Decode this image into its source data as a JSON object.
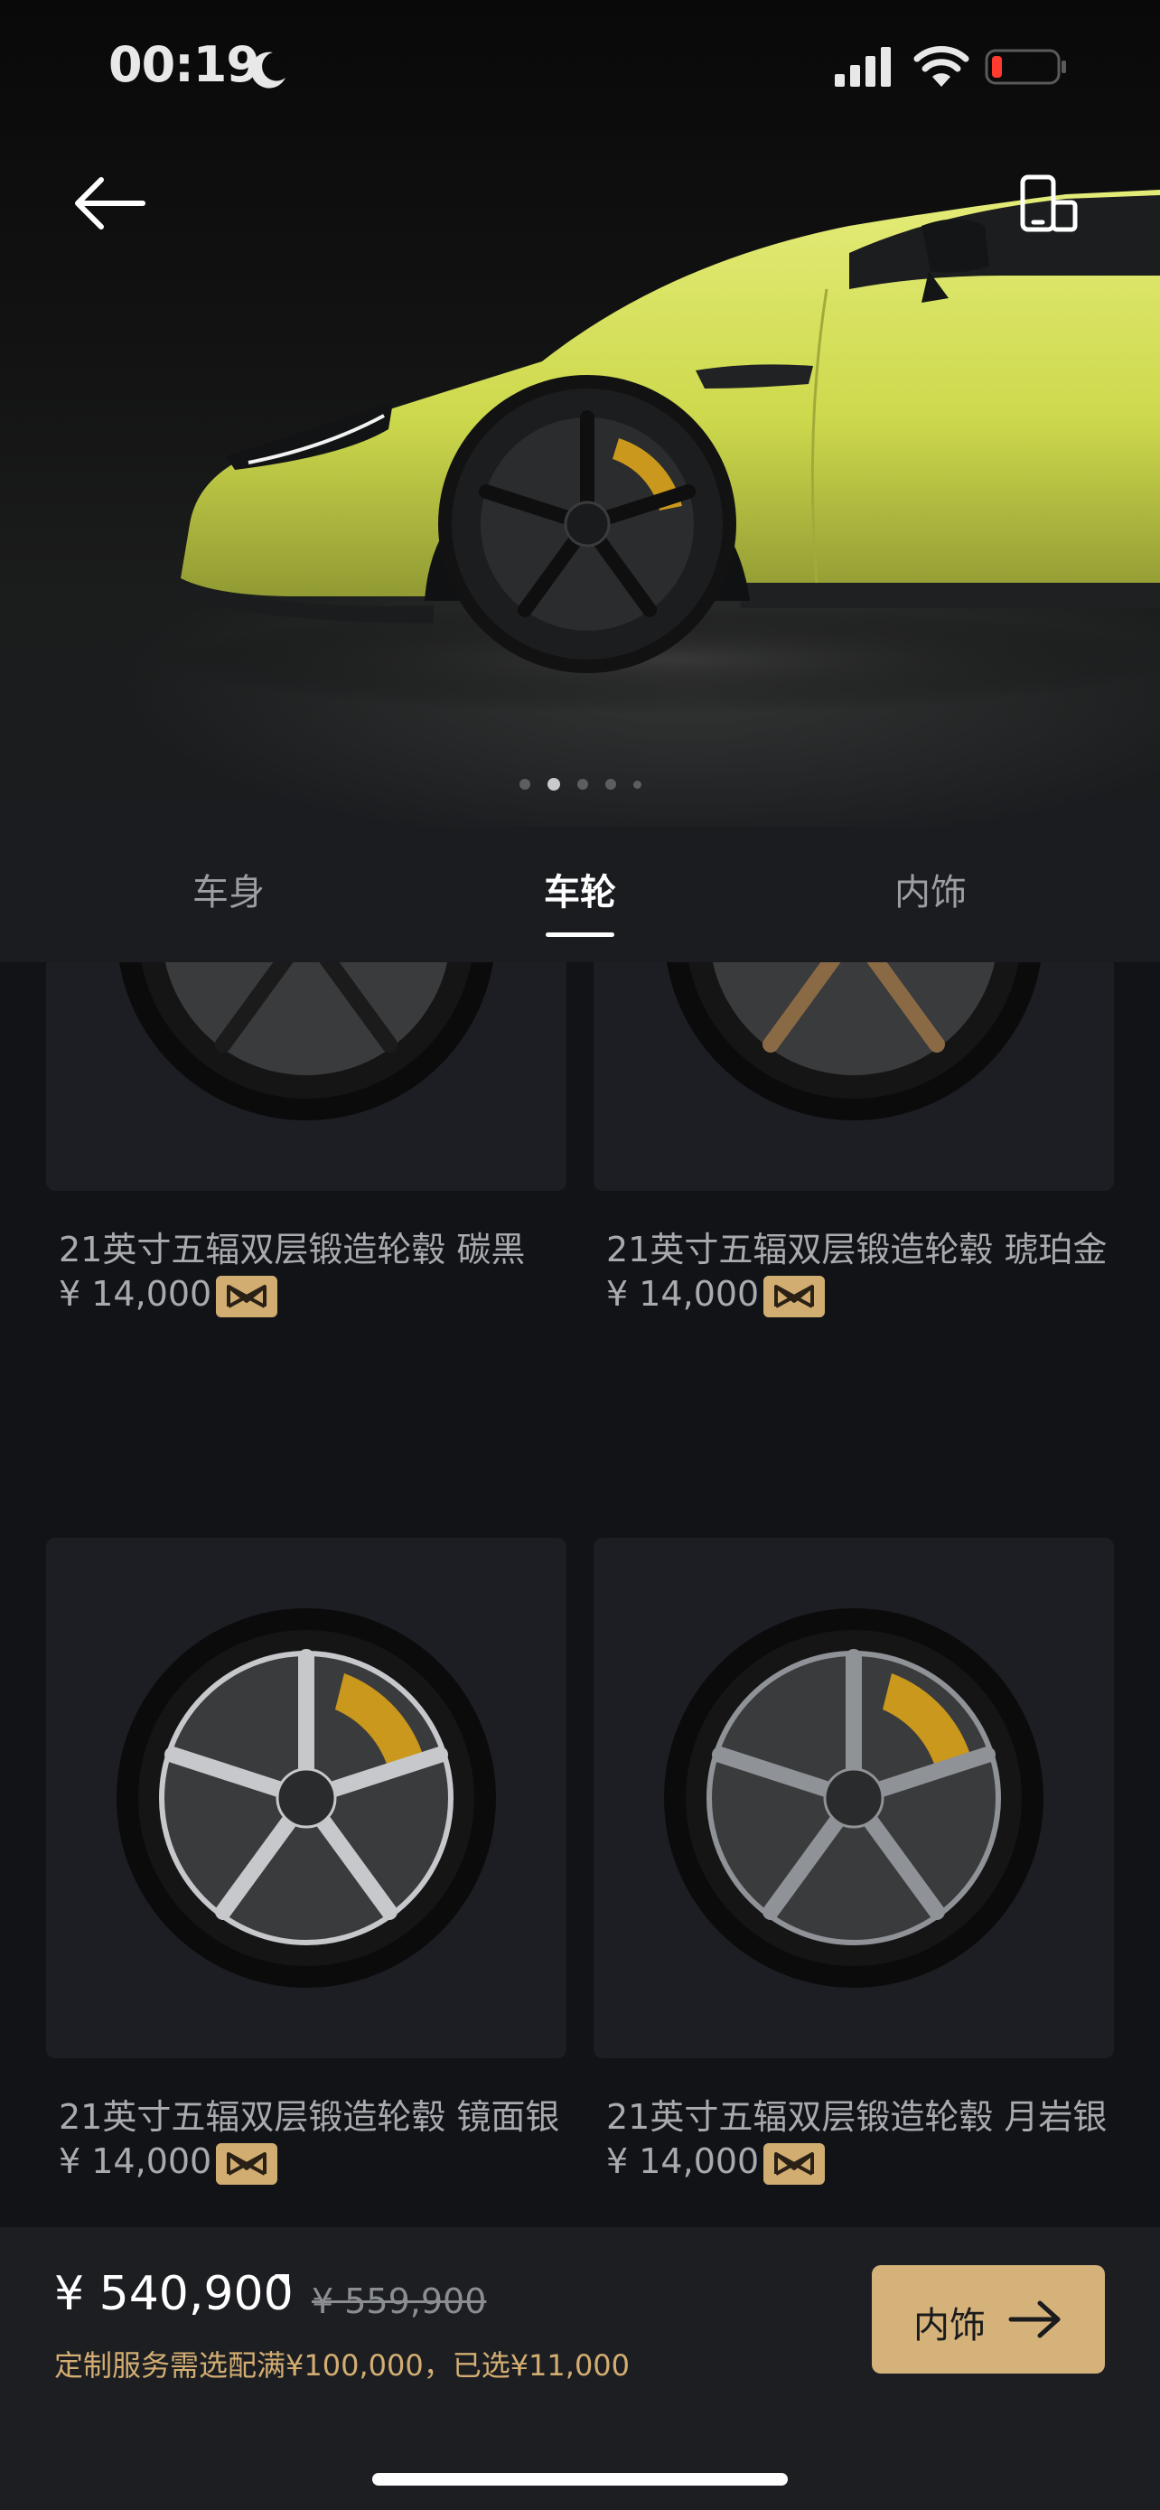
{
  "status_bar": {
    "time": "00:19",
    "icons": [
      "moon-icon",
      "signal-icon",
      "wifi-icon",
      "battery-icon"
    ]
  },
  "header": {
    "back_icon": "arrow-left-icon",
    "rotate_icon": "phone-rotate-icon"
  },
  "carousel": {
    "count": 5,
    "active_index": 1
  },
  "tabs": [
    {
      "label": "车身",
      "active": false
    },
    {
      "label": "车轮",
      "active": true
    },
    {
      "label": "内饰",
      "active": false
    }
  ],
  "wheels": [
    {
      "name": "21英寸五辐双层锻造轮毂 碳黑",
      "price": "¥ 14,000",
      "finish": "carbon-black",
      "color": "#1b1b1c"
    },
    {
      "name": "21英寸五辐双层锻造轮毂 琥珀金",
      "price": "¥ 14,000",
      "finish": "amber-gold",
      "color": "#8a6a45"
    },
    {
      "name": "21英寸五辐双层锻造轮毂 镜面银",
      "price": "¥ 14,000",
      "finish": "mirror-silver",
      "color": "#c6c8cb"
    },
    {
      "name": "21英寸五辐双层锻造轮毂 月岩银",
      "price": "¥ 14,000",
      "finish": "moonrock-silver",
      "color": "#8f9296"
    }
  ],
  "bottom_bar": {
    "total_price": "¥ 540,900",
    "original_price": "¥ 559,900",
    "note": "定制服务需选配满¥100,000，已选¥11,000",
    "next_button_label": "内饰",
    "next_icon": "arrow-right-icon"
  },
  "colors": {
    "accent_gold": "#d6b27b",
    "note_gold": "#d3ad72",
    "car_body": "#d3e05a",
    "caliper": "#c9981c",
    "background": "#111317"
  }
}
